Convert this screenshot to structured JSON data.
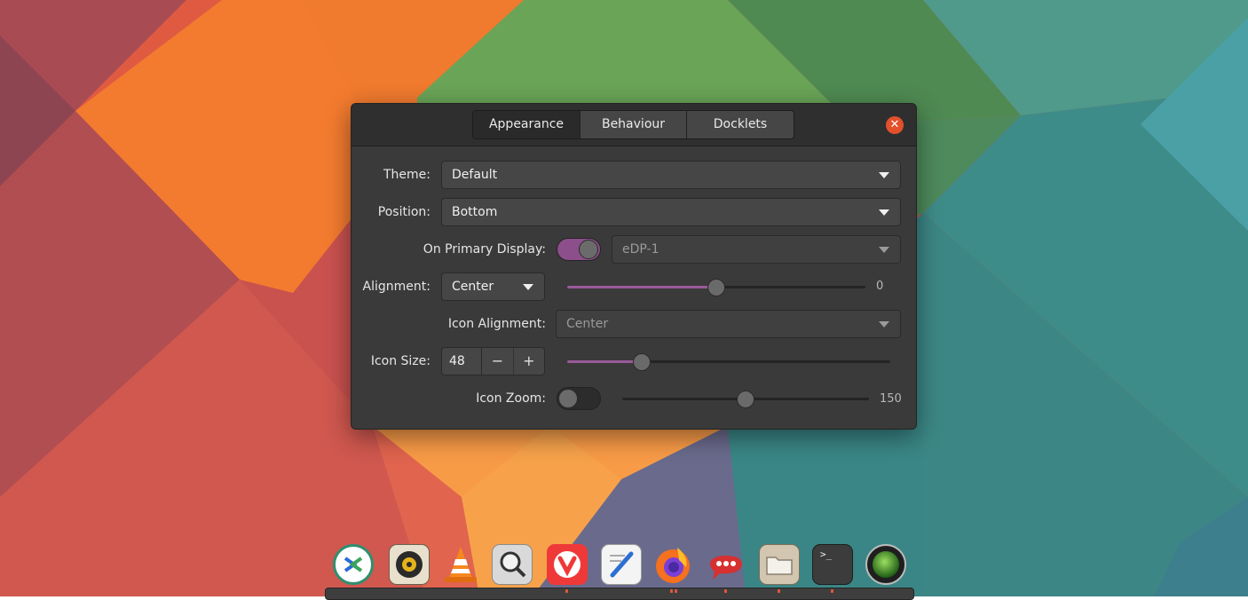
{
  "tabs": [
    {
      "label": "Appearance",
      "active": true
    },
    {
      "label": "Behaviour",
      "active": false
    },
    {
      "label": "Docklets",
      "active": false
    }
  ],
  "settings": {
    "theme": {
      "label": "Theme:",
      "value": "Default"
    },
    "position": {
      "label": "Position:",
      "value": "Bottom"
    },
    "primary_display": {
      "label": "On Primary Display:",
      "enabled": true,
      "value": "eDP-1"
    },
    "alignment": {
      "label": "Alignment:",
      "value": "Center",
      "offset": "0",
      "offset_fraction": 0.5
    },
    "icon_alignment": {
      "label": "Icon Alignment:",
      "value": "Center"
    },
    "icon_size": {
      "label": "Icon Size:",
      "value": "48",
      "minus": "−",
      "plus": "+",
      "slider_fraction": 0.23
    },
    "icon_zoom": {
      "label": "Icon Zoom:",
      "enabled": false,
      "value": "150",
      "slider_fraction": 0.5
    }
  },
  "colors": {
    "accent": "#9a5a9a",
    "close_button": "#e2502c",
    "window_bg": "#3a3a3a"
  },
  "dock": {
    "items": [
      {
        "name": "remote-desktop-icon"
      },
      {
        "name": "music-player-icon"
      },
      {
        "name": "vlc-icon"
      },
      {
        "name": "image-viewer-icon"
      },
      {
        "name": "vivaldi-icon"
      },
      {
        "name": "text-editor-icon"
      },
      {
        "name": "firefox-icon"
      },
      {
        "name": "chat-icon"
      },
      {
        "name": "files-icon"
      },
      {
        "name": "terminal-icon",
        "text": ">_"
      },
      {
        "name": "system-monitor-icon"
      }
    ]
  }
}
